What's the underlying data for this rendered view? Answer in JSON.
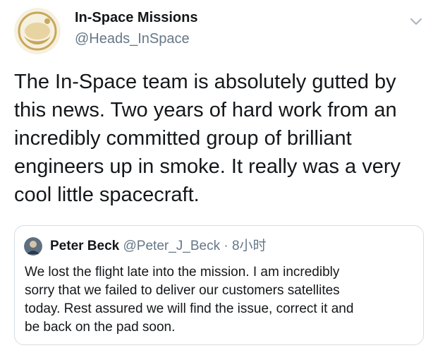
{
  "author": {
    "name": "In-Space Missions",
    "handle": "@Heads_InSpace"
  },
  "menu_icon": "chevron-down-icon",
  "tweet": {
    "lines": [
      "The In-Space team is absolutely gutted by",
      "this news.  Two years of hard work from an",
      "incredibly committed group of brilliant",
      "engineers up in smoke.  It really was a very",
      "cool little spacecraft."
    ]
  },
  "quoted": {
    "name": "Peter Beck",
    "handle": "@Peter_J_Beck",
    "separator": "·",
    "time": "8小时",
    "lines": [
      "We lost the flight late into the mission. I am incredibly",
      "sorry that we failed to deliver our customers satellites",
      "today. Rest assured we will find the issue, correct it and",
      "be back on the pad soon."
    ]
  },
  "colors": {
    "text": "#14171a",
    "secondary": "#657786",
    "border": "#d6dde3",
    "logo_gold": "#c9a75a"
  }
}
